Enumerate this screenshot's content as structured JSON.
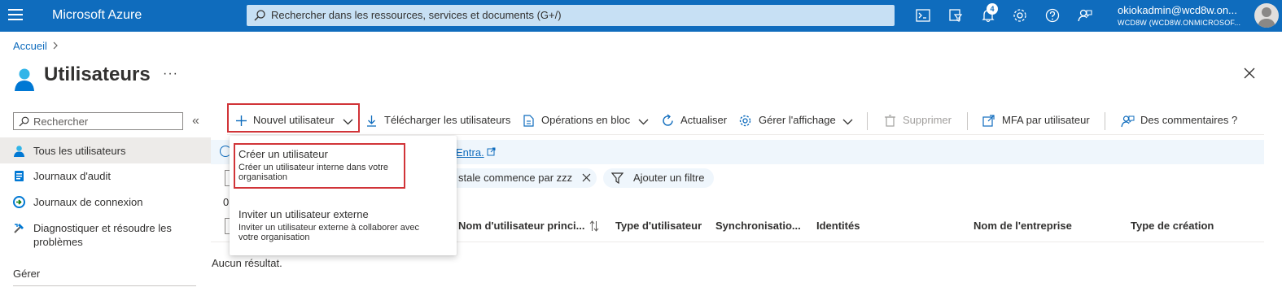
{
  "topbar": {
    "brand": "Microsoft Azure",
    "search_placeholder": "Rechercher dans les ressources, services et documents (G+/)",
    "notification_count": "4",
    "user_name": "okiokadmin@wcd8w.on...",
    "user_tenant": "WCD8W (WCD8W.ONMICROSOF...",
    "icons": [
      "cloud-shell-icon",
      "directory-filter-icon",
      "notifications-icon",
      "settings-icon",
      "help-icon",
      "feedback-icon"
    ]
  },
  "breadcrumb": {
    "home": "Accueil"
  },
  "page": {
    "title": "Utilisateurs",
    "more": "···"
  },
  "nav": {
    "search_placeholder": "Rechercher",
    "collapse": "«",
    "items": [
      {
        "label": "Tous les utilisateurs",
        "icon": "user-icon",
        "active": true
      },
      {
        "label": "Journaux d'audit",
        "icon": "audit-log-icon"
      },
      {
        "label": "Journaux de connexion",
        "icon": "sign-in-log-icon"
      },
      {
        "label": "Diagnostiquer et résoudre les problèmes",
        "label_line1": "Diagnostiquer et résoudre les",
        "label_line2": "problèmes",
        "icon": "diagnose-icon"
      }
    ],
    "section_manage": "Gérer"
  },
  "commands": {
    "new_user": "Nouvel utilisateur",
    "download": "Télécharger les utilisateurs",
    "bulk": "Opérations en bloc",
    "refresh": "Actualiser",
    "manage_view": "Gérer l'affichage",
    "delete": "Supprimer",
    "mfa": "MFA par utilisateur",
    "feedback": "Des commentaires ?"
  },
  "info": {
    "link_text": "Entra."
  },
  "filters": {
    "active_filter": "stale commence par zzz",
    "add_filter": "Ajouter un filtre",
    "count_prefix": "0"
  },
  "table": {
    "columns": [
      "Nom d'utilisateur princi...",
      "Type d'utilisateur",
      "Synchronisatio...",
      "Identités",
      "Nom de l'entreprise",
      "Type de création"
    ],
    "empty": "Aucun résultat."
  },
  "dropdown": {
    "items": [
      {
        "title": "Créer un utilisateur",
        "desc1": "Créer un utilisateur interne dans votre",
        "desc2": "organisation"
      },
      {
        "title": "Inviter un utilisateur externe",
        "desc1": "Inviter un utilisateur externe à collaborer avec",
        "desc2": "votre organisation"
      }
    ]
  },
  "colors": {
    "accent": "#0f6cbd",
    "highlight": "#d13438",
    "active_nav": "#edebe9"
  }
}
